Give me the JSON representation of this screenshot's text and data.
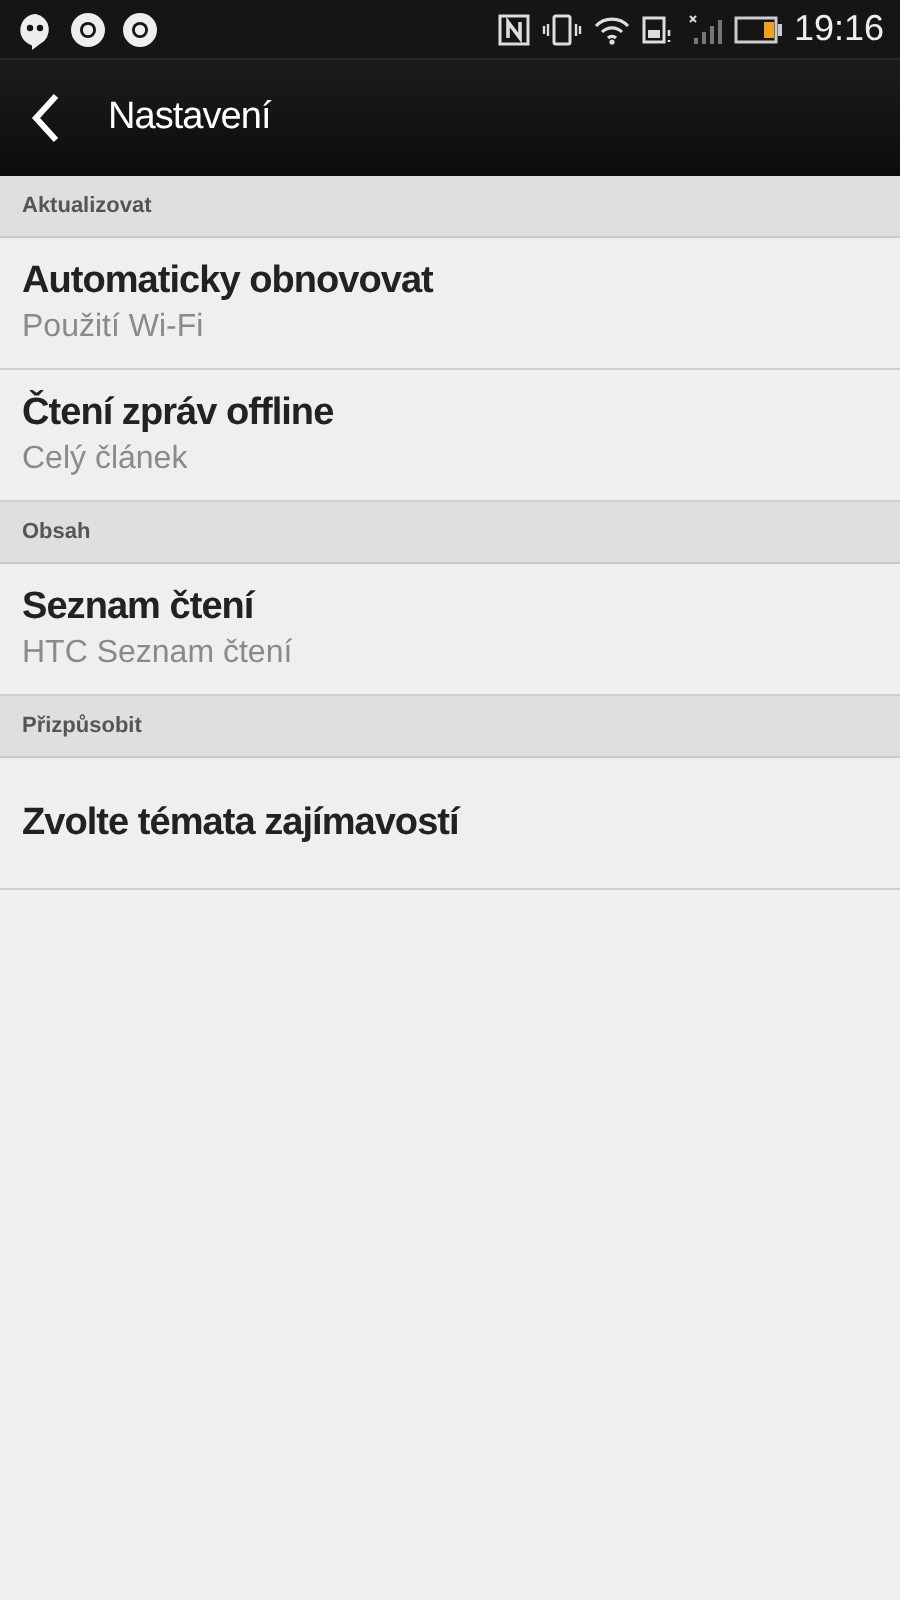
{
  "status_bar": {
    "time": "19:16"
  },
  "action_bar": {
    "title": "Nastavení"
  },
  "sections": [
    {
      "header": "Aktualizovat",
      "items": [
        {
          "title": "Automaticky obnovovat",
          "summary": "Použití Wi-Fi"
        },
        {
          "title": "Čtení zpráv offline",
          "summary": "Celý článek"
        }
      ]
    },
    {
      "header": "Obsah",
      "items": [
        {
          "title": "Seznam čtení",
          "summary": "HTC Seznam čtení"
        }
      ]
    },
    {
      "header": "Přizpůsobit",
      "items": [
        {
          "title": "Zvolte témata zajímavostí"
        }
      ]
    }
  ]
}
